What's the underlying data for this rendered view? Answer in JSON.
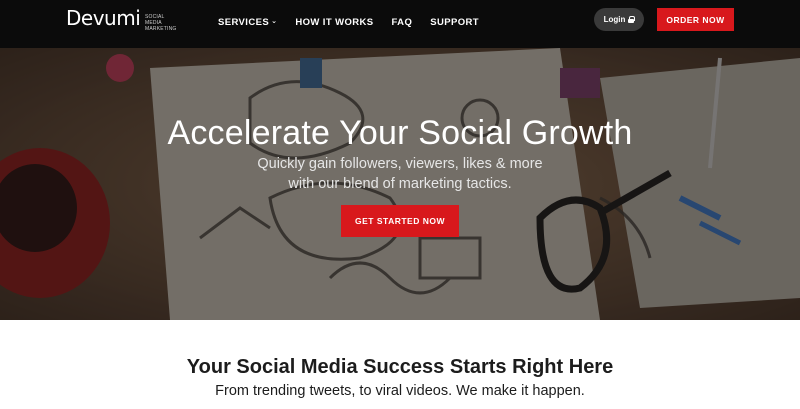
{
  "brand": {
    "name": "Devumi",
    "tagline": "SOCIAL MEDIA MARKETING"
  },
  "nav": {
    "items": [
      {
        "label": "SERVICES",
        "has_dropdown": true
      },
      {
        "label": "HOW IT WORKS"
      },
      {
        "label": "FAQ"
      },
      {
        "label": "SUPPORT"
      }
    ],
    "login_label": "Login",
    "order_label": "ORDER NOW"
  },
  "hero": {
    "title": "Accelerate Your Social Growth",
    "subtitle_line1": "Quickly gain followers, viewers, likes & more",
    "subtitle_line2": "with our blend of marketing tactics.",
    "cta_label": "GET STARTED NOW"
  },
  "section": {
    "title": "Your Social Media Success Starts Right Here",
    "subtitle": "From trending tweets, to viral videos. We make it happen."
  },
  "colors": {
    "accent": "#d8181c",
    "header_bg": "#0b0b0b",
    "login_bg": "#3a3a3a"
  },
  "icons": {
    "dropdown": "chevron-down-icon",
    "login": "lock-icon"
  }
}
